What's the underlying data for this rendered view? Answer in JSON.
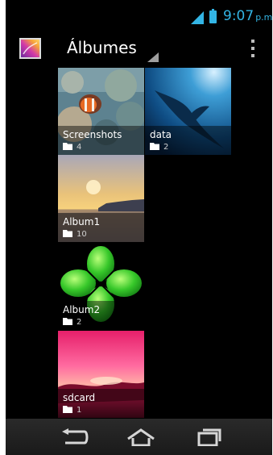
{
  "status_bar": {
    "time": "9:07",
    "ampm": "p.m.",
    "signal_icon": "signal-icon",
    "battery_icon": "battery-icon",
    "accent_color": "#33b5e5"
  },
  "action_bar": {
    "title": "Álbumes",
    "app_icon": "gallery-app-icon",
    "menu_icon": "overflow-menu-icon"
  },
  "albums": [
    {
      "name": "Screenshots",
      "count": "4"
    },
    {
      "name": "data",
      "count": "2"
    },
    {
      "name": "Album1",
      "count": "10"
    },
    {
      "name": "Album2",
      "count": "2"
    },
    {
      "name": "sdcard",
      "count": "1"
    }
  ],
  "nav_bar": {
    "back_icon": "back-icon",
    "home_icon": "home-icon",
    "recents_icon": "recent-apps-icon"
  }
}
